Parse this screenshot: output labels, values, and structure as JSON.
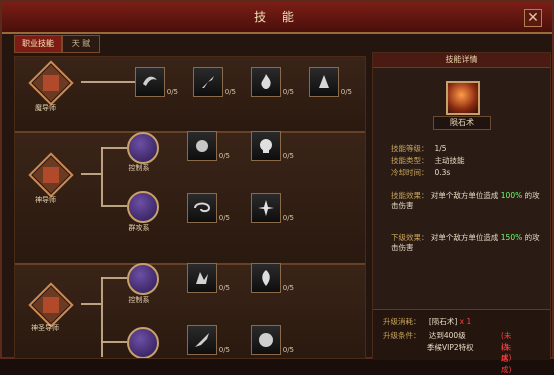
{
  "window": {
    "title": "技 能",
    "close_symbol": "✕"
  },
  "tabs": [
    {
      "label": "职业技能",
      "active": true
    },
    {
      "label": "天 赋",
      "active": false
    }
  ],
  "left": {
    "sections": [
      {
        "class_label": "魔导师",
        "row": {
          "skills": [
            {
              "icon": "wind-icon",
              "level": "0/5"
            },
            {
              "icon": "slash-icon",
              "level": "0/5"
            },
            {
              "icon": "fire-icon",
              "level": "0/5"
            },
            {
              "icon": "spike-icon",
              "level": "0/5"
            }
          ]
        }
      },
      {
        "class_label": "神导师",
        "branches": [
          {
            "label": "控制系",
            "skills": [
              {
                "icon": "burst-icon",
                "level": "0/5"
              },
              {
                "icon": "skull-icon",
                "level": "0/5"
              }
            ]
          },
          {
            "label": "群攻系",
            "skills": [
              {
                "icon": "whirl-icon",
                "level": "0/5"
              },
              {
                "icon": "light-icon",
                "level": "0/5"
              }
            ]
          }
        ]
      },
      {
        "class_label": "神圣导师",
        "branches": [
          {
            "label": "控制系",
            "skills": [
              {
                "icon": "shard-icon",
                "level": "0/5"
              },
              {
                "icon": "flame-icon",
                "level": "0/5"
              }
            ]
          },
          {
            "label": "",
            "skills": [
              {
                "icon": "blade-icon",
                "level": "0/5"
              },
              {
                "icon": "orb-icon",
                "level": "0/5"
              }
            ]
          }
        ]
      }
    ]
  },
  "right": {
    "panel_title": "技能详情",
    "skill_name": "陨石术",
    "details": [
      {
        "k": "技能等级：",
        "v": "1/5"
      },
      {
        "k": "技能类型：",
        "v": "主动技能"
      },
      {
        "k": "冷却时间：",
        "v": "0.3s"
      }
    ],
    "effect_current": {
      "k": "技能效果：",
      "text_before": "对单个敌方单位造成",
      "hl": "100%",
      "text_after": "的攻击伤害"
    },
    "effect_next": {
      "k": "下级效果：",
      "text_before": "对单个敌方单位造成",
      "hl": "150%",
      "text_after": "的攻击伤害"
    },
    "upgrade_cost": {
      "k": "升级消耗：",
      "item": "[陨石术]",
      "qty": "x 1"
    },
    "upgrade_cond": {
      "k": "升级条件：",
      "c1": "达到400级",
      "c2": "季候VIP2特权",
      "status1": "(未达成)",
      "status2": "(未达成)"
    }
  },
  "colors": {
    "accent": "#7d1c14",
    "highlight": "#6cff6c",
    "warning": "#ff4040"
  }
}
